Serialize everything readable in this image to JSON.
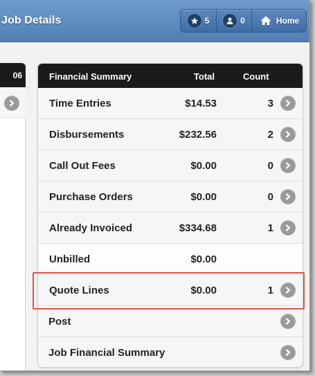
{
  "header": {
    "title": "Job Details",
    "buttons": [
      {
        "icon": "star-icon",
        "label": "5"
      },
      {
        "icon": "user-icon",
        "label": "0"
      },
      {
        "icon": "home-icon",
        "label": "Home"
      }
    ]
  },
  "left_panel": {
    "header_text": "06",
    "row_icon": "chevron-right-icon"
  },
  "financial_summary": {
    "columns": {
      "name": "Financial Summary",
      "total": "Total",
      "count": "Count"
    },
    "rows": [
      {
        "label": "Time Entries",
        "total": "$14.53",
        "count": "3",
        "has_arrow": true
      },
      {
        "label": "Disbursements",
        "total": "$232.56",
        "count": "2",
        "has_arrow": true
      },
      {
        "label": "Call Out Fees",
        "total": "$0.00",
        "count": "0",
        "has_arrow": true
      },
      {
        "label": "Purchase Orders",
        "total": "$0.00",
        "count": "0",
        "has_arrow": true
      },
      {
        "label": "Already Invoiced",
        "total": "$334.68",
        "count": "1",
        "has_arrow": true
      },
      {
        "label": "Unbilled",
        "total": "$0.00",
        "count": "",
        "has_arrow": false
      },
      {
        "label": "Quote Lines",
        "total": "$0.00",
        "count": "1",
        "has_arrow": true,
        "highlighted": true
      },
      {
        "label": "Post",
        "total": "",
        "count": "",
        "has_arrow": true
      },
      {
        "label": "Job Financial Summary",
        "total": "",
        "count": "",
        "has_arrow": true
      }
    ]
  },
  "colors": {
    "header": "#5a8abf",
    "panel_header": "#1b1b1b",
    "highlight": "#d9534f",
    "arrow": "#9a9a9a"
  }
}
